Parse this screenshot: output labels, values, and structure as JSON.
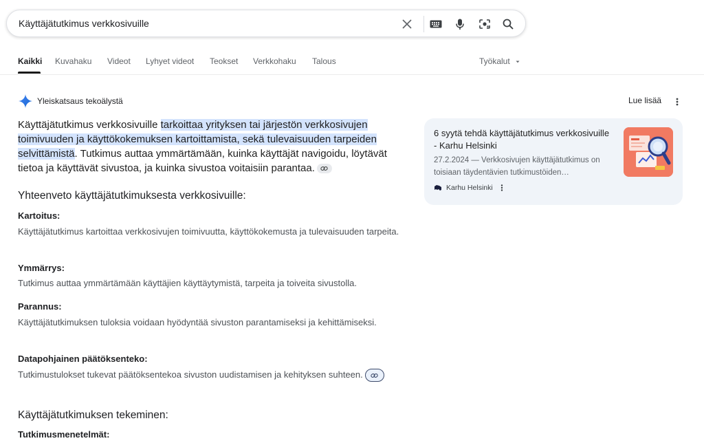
{
  "search": {
    "query": "Käyttäjätutkimus verkkosivuille"
  },
  "tabs": [
    {
      "label": "Kaikki",
      "active": true
    },
    {
      "label": "Kuvahaku"
    },
    {
      "label": "Videot"
    },
    {
      "label": "Lyhyet videot"
    },
    {
      "label": "Teokset"
    },
    {
      "label": "Verkkohaku"
    },
    {
      "label": "Talous"
    }
  ],
  "tools_label": "Työkalut",
  "ai_overview": {
    "header": "Yleiskatsaus tekoälystä",
    "read_more": "Lue lisää",
    "lead_plain_1": "Käyttäjätutkimus verkkosivuille ",
    "lead_highlight": "tarkoittaa yrityksen tai järjestön verkkosivujen toimivuuden ja käyttökokemuksen kartoittamista, sekä tulevaisuuden tarpeiden selvittämistä",
    "lead_plain_2": ". Tutkimus auttaa ymmärtämään, kuinka käyttäjät navigoidu, löytävät tietoa ja käyttävät sivustoa, ja kuinka sivustoa voitaisiin parantaa.",
    "summary_heading": "Yhteenveto käyttäjätutkimuksesta verkkosivuille:",
    "items": [
      {
        "title": "Kartoitus:",
        "body": "Käyttäjätutkimus kartoittaa verkkosivujen toimivuutta, käyttökokemusta ja tulevaisuuden tarpeita."
      },
      {
        "title": "Ymmärrys:",
        "body": "Tutkimus auttaa ymmärtämään käyttäjien käyttäytymistä, tarpeita ja toiveita sivustolla."
      },
      {
        "title": "Parannus:",
        "body": "Käyttäjätutkimuksen tuloksia voidaan hyödyntää sivuston parantamiseksi ja kehittämiseksi."
      },
      {
        "title": "Datapohjainen päätöksenteko:",
        "body": "Tutkimustulokset tukevat päätöksentekoa sivuston uudistamisen ja kehityksen suhteen."
      }
    ],
    "doing_heading": "Käyttäjätutkimuksen tekeminen:",
    "methods_title": "Tutkimusmenetelmät:"
  },
  "card": {
    "title": "6 syytä tehdä käyttäjätutkimus verkkosivuille - Karhu Helsinki",
    "snippet": "27.2.2024 — Verkkosivujen käyttäjätutkimus on toisiaan täydentävien tutkimustöiden…",
    "source": "Karhu Helsinki"
  },
  "colors": {
    "highlight": "#d3e3fd",
    "card_bg": "#f0f4f9",
    "thumb_bg": "#f17a62"
  }
}
